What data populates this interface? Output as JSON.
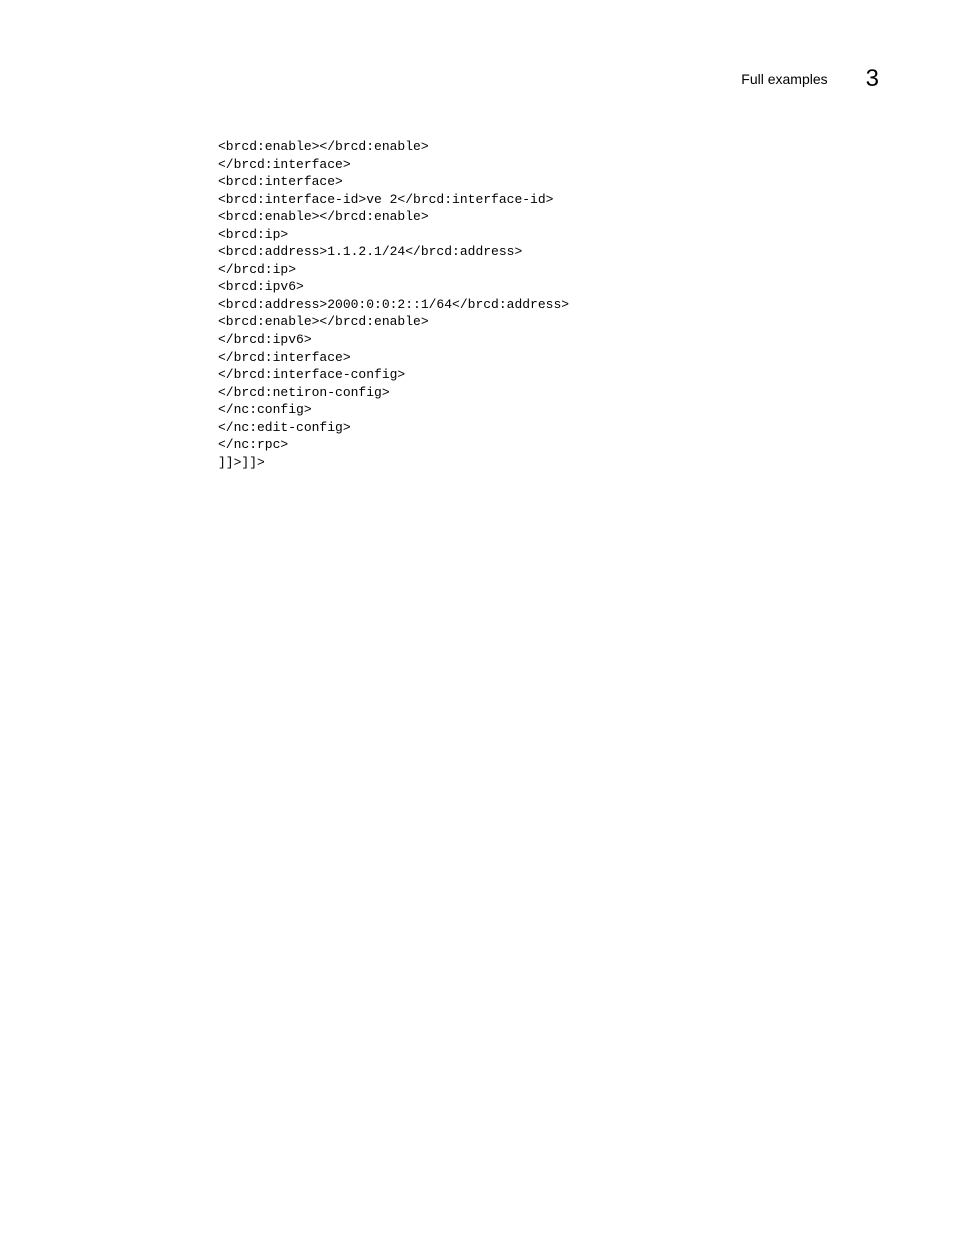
{
  "header": {
    "title": "Full examples",
    "page_number": "3"
  },
  "code": {
    "lines": [
      "<brcd:enable></brcd:enable>",
      "</brcd:interface>",
      "<brcd:interface>",
      "<brcd:interface-id>ve 2</brcd:interface-id>",
      "<brcd:enable></brcd:enable>",
      "<brcd:ip>",
      "<brcd:address>1.1.2.1/24</brcd:address>",
      "</brcd:ip>",
      "<brcd:ipv6>",
      "<brcd:address>2000:0:0:2::1/64</brcd:address>",
      "<brcd:enable></brcd:enable>",
      "</brcd:ipv6>",
      "</brcd:interface>",
      "</brcd:interface-config>",
      "</brcd:netiron-config>",
      "</nc:config>",
      "</nc:edit-config>",
      "</nc:rpc>",
      "]]>]]>"
    ]
  }
}
